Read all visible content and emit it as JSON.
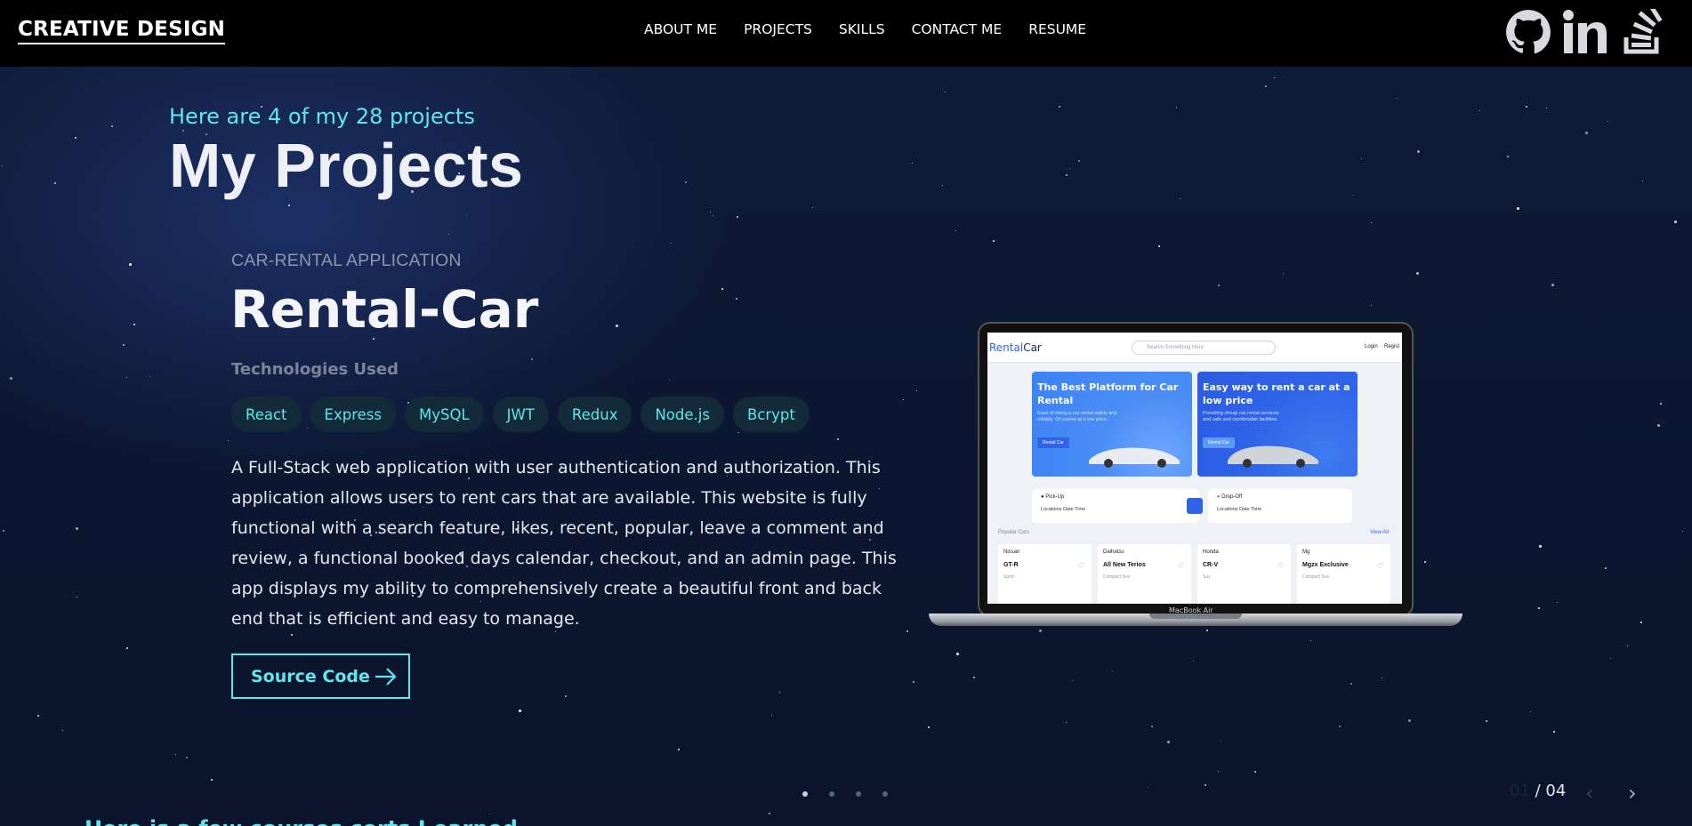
{
  "nav": {
    "brand": "CREATIVE DESIGN",
    "menu": [
      "ABOUT ME",
      "PROJECTS",
      "SKILLS",
      "CONTACT ME",
      "RESUME"
    ],
    "social_icons": [
      "github-icon",
      "linkedin-icon",
      "stack-overflow-icon"
    ]
  },
  "hero": {
    "subtitle": "Here are 4 of my 28 projects",
    "title": "My Projects"
  },
  "project": {
    "category": "CAR-RENTAL APPLICATION",
    "title": "Rental-Car",
    "tech_label": "Technologies Used",
    "technologies": [
      "React",
      "Express",
      "MySQL",
      "JWT",
      "Redux",
      "Node.js",
      "Bcrypt"
    ],
    "description": "A Full-Stack web application with user authentication and authorization. This application allows users to rent cars that are available. This website is fully functional with a search feature, likes, recent, popular, leave a comment and review, a functional booked days calendar, checkout, and an admin page. This app displays my ability to comprehensively create a beautiful front and back end that is efficient and easy to manage.",
    "source_button": "Source Code"
  },
  "preview": {
    "logo_a": "Rental",
    "logo_b": "Car",
    "search_placeholder": "Search Something Here",
    "nav_links": [
      "Login",
      "Regist"
    ],
    "banner1_title": "The Best Platform for Car Rental",
    "banner1_sub": "Ease of doing a car rental safely and reliably. Of course at a low price.",
    "banner1_btn": "Rental Car",
    "banner2_title": "Easy way to rent a car at a low price",
    "banner2_sub": "Providing cheap car rental services and safe and comfortable facilities.",
    "banner2_btn": "Rental Car",
    "pickup": "Pick-Up",
    "dropoff": "Drop-Off",
    "fields": "Locations      Date         Time",
    "popular": "Popular Cars",
    "view_all": "View All",
    "cards": [
      {
        "brand": "Nissan",
        "model": "GT-R",
        "kind": "Sport"
      },
      {
        "brand": "Daihatsu",
        "model": "All New Terios",
        "kind": "Compact Suv"
      },
      {
        "brand": "Honda",
        "model": "CR-V",
        "kind": "Suv"
      },
      {
        "brand": "Mg",
        "model": "Mgzx Exclusive",
        "kind": "Compact Suv"
      }
    ],
    "device_label": "MacBook Air"
  },
  "slider": {
    "current": "01",
    "total": "/ 04",
    "slides": 4,
    "active_index": 0,
    "prev": "‹",
    "next": "›"
  },
  "next_section_heading": "Here is a few courses certs I earned"
}
